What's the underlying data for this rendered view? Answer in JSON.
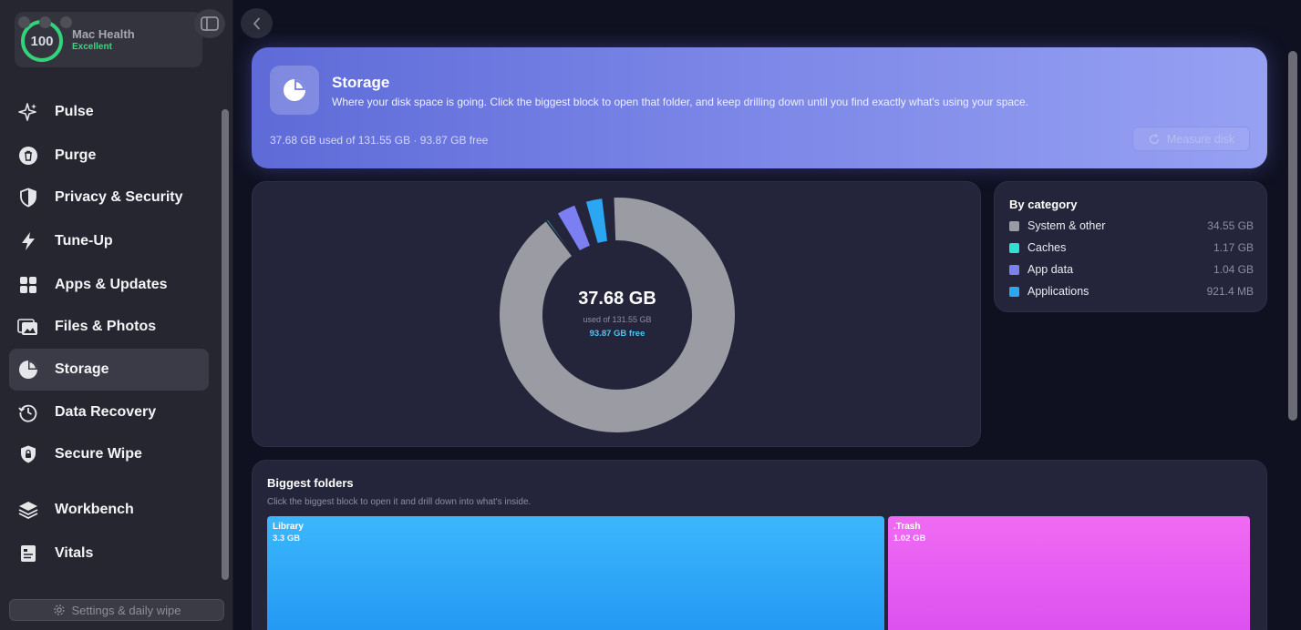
{
  "sidebar": {
    "health": {
      "score": "100",
      "title": "Mac Health",
      "status": "Excellent"
    },
    "items": [
      {
        "label": "Pulse",
        "icon": "sparkle-icon"
      },
      {
        "label": "Purge",
        "icon": "trash-icon"
      },
      {
        "label": "Privacy & Security",
        "icon": "shield-icon"
      },
      {
        "label": "Tune-Up",
        "icon": "bolt-icon"
      },
      {
        "label": "Apps & Updates",
        "icon": "apps-grid-icon"
      },
      {
        "label": "Files & Photos",
        "icon": "photos-icon"
      },
      {
        "label": "Storage",
        "icon": "pie-chart-icon",
        "active": true
      },
      {
        "label": "Data Recovery",
        "icon": "history-icon"
      },
      {
        "label": "Secure Wipe",
        "icon": "lock-shield-icon"
      },
      {
        "label": "Workbench",
        "icon": "layers-icon"
      },
      {
        "label": "Vitals",
        "icon": "vitals-icon"
      }
    ],
    "settings_label": "Settings & daily wipe"
  },
  "hero": {
    "title": "Storage",
    "description": "Where your disk space is going. Click the biggest block to open that folder, and keep drilling down until you find exactly what's using your space.",
    "usage": "37.68 GB used of 131.55 GB · 93.87 GB free",
    "measure_label": "Measure disk"
  },
  "donut": {
    "total": "37.68 GB",
    "used_of": "used of 131.55 GB",
    "free": "93.87 GB free"
  },
  "categories": {
    "title": "By category",
    "items": [
      {
        "name": "System & other",
        "value": "34.55 GB",
        "color": "#9b9ca3"
      },
      {
        "name": "Caches",
        "value": "1.17 GB",
        "color": "#2fe0cf"
      },
      {
        "name": "App data",
        "value": "1.04 GB",
        "color": "#7b7ff2"
      },
      {
        "name": "Applications",
        "value": "921.4 MB",
        "color": "#2aa6f2"
      }
    ]
  },
  "chart_data": {
    "type": "pie",
    "categories": [
      "System & other",
      "Caches",
      "App data",
      "Applications"
    ],
    "values": [
      34.55,
      1.17,
      1.04,
      0.9214
    ],
    "unit": "GB"
  },
  "folders": {
    "title": "Biggest folders",
    "subtitle": "Click the biggest block to open it and drill down into what's inside.",
    "blocks": [
      {
        "name": "Library",
        "size": "3.3 GB",
        "color_top": "#3cb7fb",
        "color_bottom": "#2196f3"
      },
      {
        "name": ".Trash",
        "size": "1.02 GB",
        "color_top": "#f06bf3",
        "color_bottom": "#d94ef0"
      }
    ]
  }
}
